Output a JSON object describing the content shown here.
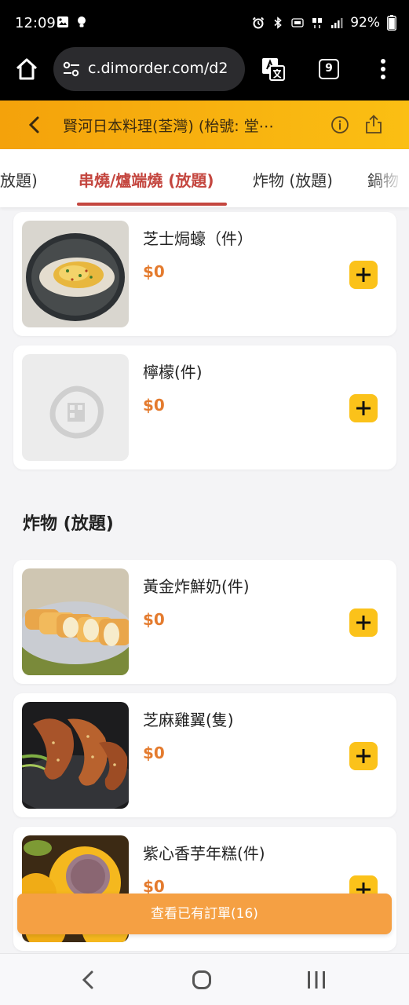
{
  "status_bar": {
    "time": "12:09",
    "battery": "92%"
  },
  "browser": {
    "url": "c.dimorder.com/d2",
    "tab_count": "9"
  },
  "header": {
    "title": "賢河日本料理(荃灣) (枱號: 堂⋯"
  },
  "category_tabs": [
    {
      "label": "放題)"
    },
    {
      "label": "串燒/爐端燒 (放題)",
      "active": true
    },
    {
      "label": "炸物 (放題)"
    },
    {
      "label": "鍋物"
    }
  ],
  "items_top": [
    {
      "name": "芝士焗蠔（件）",
      "price": "$0",
      "image": "baked-oyster-photo"
    },
    {
      "name": "檸檬(件)",
      "price": "$0",
      "image": "placeholder-logo"
    }
  ],
  "section": {
    "title": "炸物 (放題)"
  },
  "items_fried": [
    {
      "name": "黃金炸鮮奶(件)",
      "price": "$0",
      "image": "fried-milk-photo"
    },
    {
      "name": "芝麻雞翼(隻)",
      "price": "$0",
      "image": "sesame-wings-photo"
    },
    {
      "name": "紫心香芋年糕(件)",
      "price": "$0",
      "image": "taro-cake-photo"
    }
  ],
  "order_bar": {
    "label": "查看已有訂單(16)"
  },
  "colors": {
    "accent_orange": "#f4a20b",
    "active_tab": "#c4463f",
    "price": "#e47b2e",
    "add_button": "#fbc21a",
    "order_bar": "#f5a043"
  }
}
